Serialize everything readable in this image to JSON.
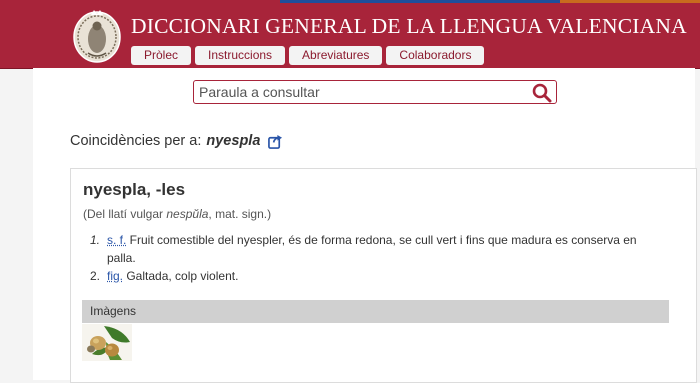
{
  "colors": {
    "header_bg": "#a8243a",
    "accent": "#a8243a",
    "link": "#2a55a8",
    "strip": [
      "#a8243a",
      "#1f4e9c",
      "#c86b1e"
    ]
  },
  "header": {
    "title": "DICCIONARI GENERAL DE LA LLENGUA VALENCIANA",
    "logo": "seal-logo-icon",
    "nav": [
      "Pròlec",
      "Instruccions",
      "Abreviatures",
      "Colaboradors"
    ]
  },
  "search": {
    "placeholder": "Paraula a consultar",
    "value": "",
    "icon": "search-icon"
  },
  "results": {
    "label": "Coincidències per a:",
    "term": "nyespla",
    "share_icon": "share-link-icon"
  },
  "entry": {
    "headword": "nyespla, -les",
    "etym_prefix": "(Del llatí vulgar ",
    "etym_word": "nespŭla",
    "etym_suffix": ", mat. sign.)",
    "definitions": [
      {
        "num": "1.",
        "abbr": "s. f.",
        "text": " Fruit comestible del nyespler, és de forma redona, se cull vert i fins que madura es conserva en palla."
      },
      {
        "num": "2.",
        "abbr": "fig.",
        "text": " Galtada, colp violent."
      }
    ]
  },
  "images": {
    "label": "Imàgens",
    "thumbnail": "loquat-fruit-thumbnail"
  }
}
